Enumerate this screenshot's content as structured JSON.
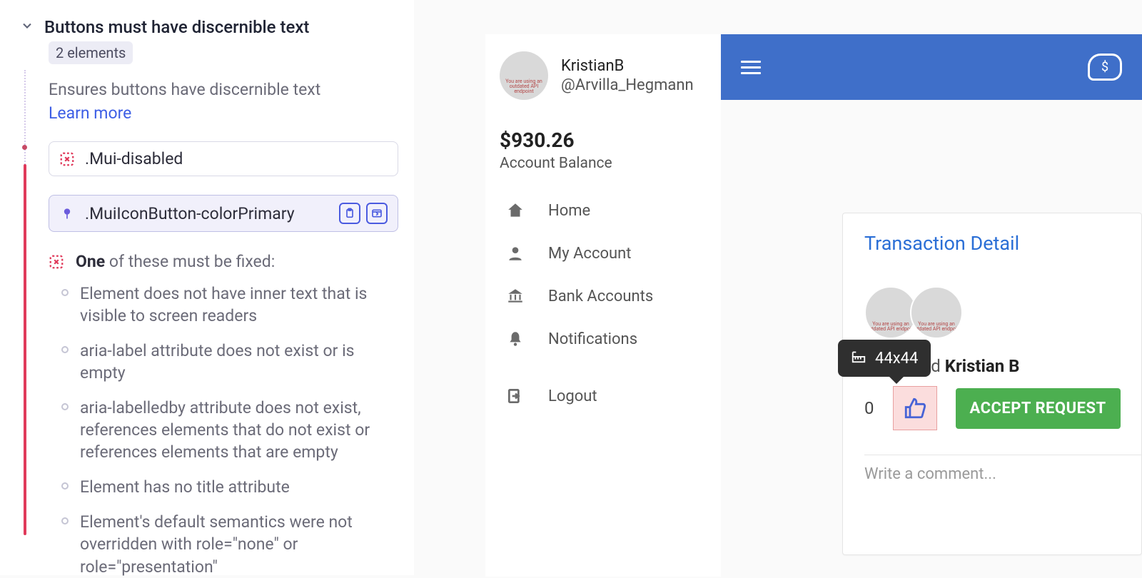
{
  "audit": {
    "title": "Buttons must have discernible text",
    "elements_badge": "2 elements",
    "description": "Ensures buttons have discernible text",
    "learn_more": "Learn more",
    "selectors": [
      {
        "text": ".Mui-disabled"
      },
      {
        "text": ".MuiIconButton-colorPrimary"
      }
    ],
    "fix_heading_bold": "One",
    "fix_heading_rest": " of these must be fixed:",
    "fixes": [
      "Element does not have inner text that is visible to screen readers",
      "aria-label attribute does not exist or is empty",
      "aria-labelledby attribute does not exist, references elements that do not exist or references elements that are empty",
      "Element has no title attribute",
      "Element's default semantics were not overridden with role=\"none\" or role=\"presentation\""
    ]
  },
  "app": {
    "user": {
      "name": "KristianB",
      "handle": "@Arvilla_Hegmann"
    },
    "balance": {
      "amount": "$930.26",
      "label": "Account Balance"
    },
    "nav": {
      "home": "Home",
      "my_account": "My Account",
      "bank": "Bank Accounts",
      "notifications": "Notifications",
      "logout": "Logout"
    },
    "card": {
      "title": "Transaction Detail",
      "desc_requested": " requested ",
      "desc_name": "Kristian B",
      "like_count": "0",
      "accept_label": "ACCEPT REQUEST",
      "comment_placeholder": "Write a comment..."
    },
    "tooltip": "44x44",
    "avatar_err": "You are using an outdated API endpoint"
  }
}
